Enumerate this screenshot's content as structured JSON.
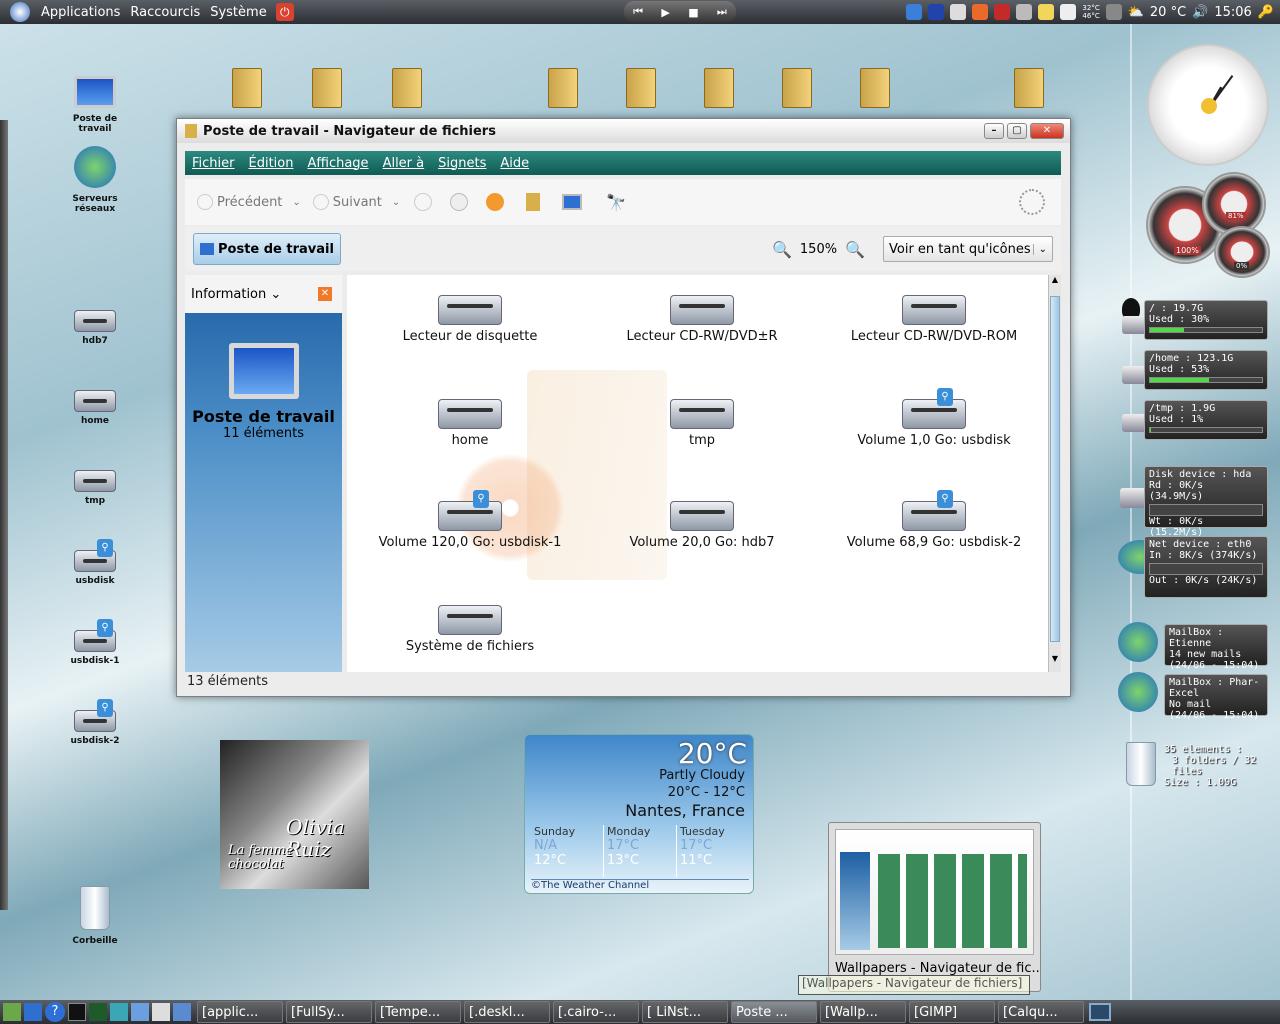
{
  "top_panel": {
    "menus": [
      "Applications",
      "Raccourcis",
      "Système"
    ],
    "temp": "20 °C",
    "clock": "15:06",
    "cpu_temps": [
      "32°C",
      "46°C"
    ]
  },
  "desktop_icons": [
    {
      "label": "Poste de travail"
    },
    {
      "label": "Serveurs réseaux"
    },
    {
      "label": "hdb7"
    },
    {
      "label": "home"
    },
    {
      "label": "tmp"
    },
    {
      "label": "usbdisk"
    },
    {
      "label": "usbdisk-1"
    },
    {
      "label": "usbdisk-2"
    },
    {
      "label": "Corbeille"
    }
  ],
  "album": {
    "artist": "Olivia Ruiz",
    "title": "La femme chocolat"
  },
  "window": {
    "title": "Poste de travail - Navigateur de fichiers",
    "menus": [
      "Fichier",
      "Édition",
      "Affichage",
      "Aller à",
      "Signets",
      "Aide"
    ],
    "toolbar": {
      "back": "Précédent",
      "forward": "Suivant"
    },
    "location": "Poste de travail",
    "zoom": "150%",
    "view_mode": "Voir en tant qu'icônes",
    "side_pane": {
      "header": "Information",
      "title": "Poste de travail",
      "count": "11 éléments"
    },
    "items": [
      "Lecteur de disquette",
      "Lecteur CD-RW/DVD±R",
      "Lecteur CD-RW/DVD-ROM",
      "home",
      "tmp",
      "Volume 1,0 Go: usbdisk",
      "Volume 120,0 Go: usbdisk-1",
      "Volume 20,0 Go: hdb7",
      "Volume 68,9 Go: usbdisk-2",
      "Système de fichiers"
    ],
    "status": "13 éléments"
  },
  "disk_widgets": [
    {
      "line1": "/ : 19.7G",
      "line2": "Used : 30%",
      "used_pct": 30
    },
    {
      "line1": "/home : 123.1G",
      "line2": "Used : 53%",
      "used_pct": 53
    },
    {
      "line1": "/tmp : 1.9G",
      "line2": "Used : 1%",
      "used_pct": 1
    }
  ],
  "io_widgets": [
    {
      "line1": "Disk device : hda",
      "line2": "Rd : 0K/s    (34.9M/s)",
      "line3": "Wt : 0K/s    (15.2M/s)"
    },
    {
      "line1": "Net device : eth0",
      "line2": "In : 8K/s     (374K/s)",
      "line3": "Out : 0K/s     (24K/s)"
    }
  ],
  "mail_widgets": [
    {
      "line1": "MailBox : Etienne",
      "line2": "14 new mails",
      "line3": "(24/06 - 15:04)"
    },
    {
      "line1": "MailBox : Phar-Excel",
      "line2": "No mail",
      "line3": "(24/06 - 15:04)"
    }
  ],
  "trash_widget": {
    "line1": "35 elements :",
    "line2": "3 folders / 32 files",
    "line3": "Size : 1.09G"
  },
  "gauges": {
    "cpu": "100%",
    "mem": "81%",
    "swap": "0%"
  },
  "weather": {
    "temp": "20°C",
    "condition": "Partly Cloudy",
    "range": "20°C - 12°C",
    "city": "Nantes, France",
    "days": [
      {
        "name": "Sunday",
        "high": "N/A",
        "low": "12°C"
      },
      {
        "name": "Monday",
        "high": "17°C",
        "low": "13°C"
      },
      {
        "name": "Tuesday",
        "high": "17°C",
        "low": "11°C"
      }
    ],
    "credit": "©The Weather Channel"
  },
  "thumbnail": {
    "label": "Wallpapers - Navigateur de fic...",
    "tooltip": "[Wallpapers - Navigateur de fichiers]"
  },
  "taskbar": [
    "[applic...",
    "[FullSy...",
    "[Tempe...",
    "[.deskl...",
    "[.cairo-...",
    "[ LiNst...",
    "Poste ...",
    "[Wallp...",
    "[GIMP]",
    "[Calqu..."
  ]
}
